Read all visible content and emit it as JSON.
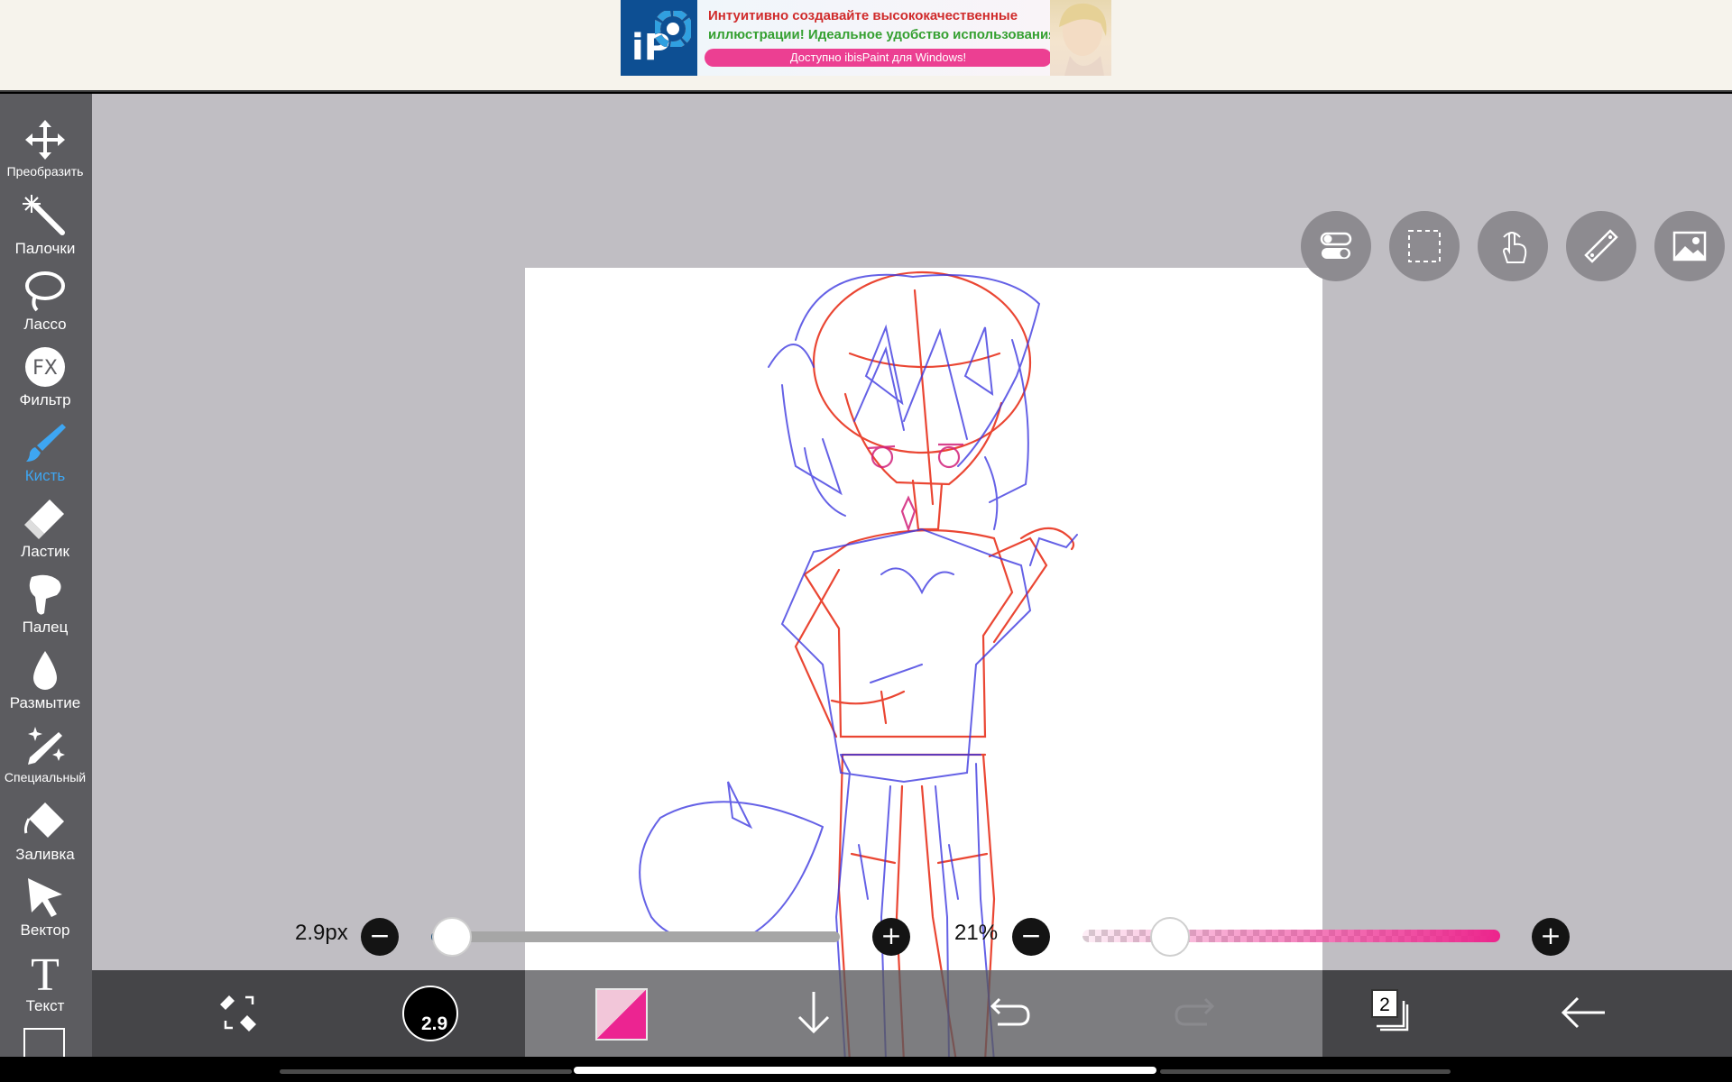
{
  "ad": {
    "logo": "iP",
    "line1": "Интуитивно создавайте высококачественные",
    "line2": "иллюстрации! Идеальное удобство использования!",
    "cta": "Доступно ibisPaint для Windows!"
  },
  "tools": [
    {
      "label": "Преобразить",
      "icon": "move-arrows-icon"
    },
    {
      "label": "Палочки",
      "icon": "magic-wand-icon"
    },
    {
      "label": "Лассо",
      "icon": "lasso-icon"
    },
    {
      "label": "Фильтр",
      "icon": "fx-filter-icon",
      "glyph": "FX"
    },
    {
      "label": "Кисть",
      "icon": "brush-icon",
      "active": true
    },
    {
      "label": "Ластик",
      "icon": "eraser-icon"
    },
    {
      "label": "Палец",
      "icon": "smudge-finger-icon"
    },
    {
      "label": "Размытие",
      "icon": "blur-drop-icon"
    },
    {
      "label": "Специальный",
      "icon": "special-pen-icon"
    },
    {
      "label": "Заливка",
      "icon": "fill-bucket-icon"
    },
    {
      "label": "Вектор",
      "icon": "vector-cursor-icon"
    },
    {
      "label": "Текст",
      "icon": "text-tool-icon",
      "glyph": "T"
    }
  ],
  "toolbar": {
    "brush_size_value": "2.9px",
    "brush_size_fraction": 0.05,
    "opacity_value": "21%",
    "opacity_fraction": 0.21,
    "minus_glyph": "−",
    "plus_glyph": "+"
  },
  "bottom": {
    "brush_size_badge": "2.9",
    "layer_count": "2",
    "primary_color": "#ec2491",
    "secondary_color": "#f2c6d9"
  },
  "colors": {
    "accent_blue": "#3ea6f2",
    "sidebar_bg": "#5c5c60",
    "workspace_bg": "#c0bec3"
  }
}
